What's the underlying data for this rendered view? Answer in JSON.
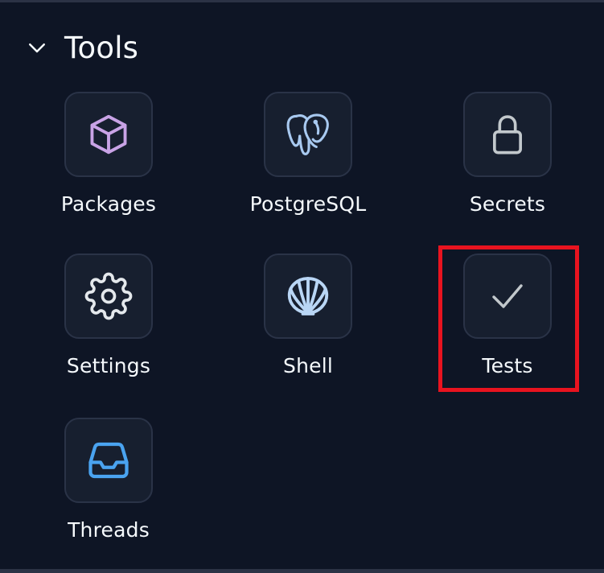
{
  "section": {
    "title": "Tools",
    "expand_icon": "chevron-down-icon"
  },
  "tools": [
    {
      "label": "Packages",
      "icon": "package-box-icon",
      "color": "#c9a3e6"
    },
    {
      "label": "PostgreSQL",
      "icon": "postgresql-elephant-icon",
      "color": "#a8c9f0"
    },
    {
      "label": "Secrets",
      "icon": "lock-icon",
      "color": "#c2c8cc"
    },
    {
      "label": "Settings",
      "icon": "gear-icon",
      "color": "#e4e8ec"
    },
    {
      "label": "Shell",
      "icon": "shell-icon",
      "color": "#b9d6f5"
    },
    {
      "label": "Tests",
      "icon": "checkmark-icon",
      "color": "#c2c8cc"
    },
    {
      "label": "Threads",
      "icon": "inbox-tray-icon",
      "color": "#4aa3f0"
    }
  ],
  "highlight": {
    "target": "Tests",
    "color": "#e8131f"
  }
}
